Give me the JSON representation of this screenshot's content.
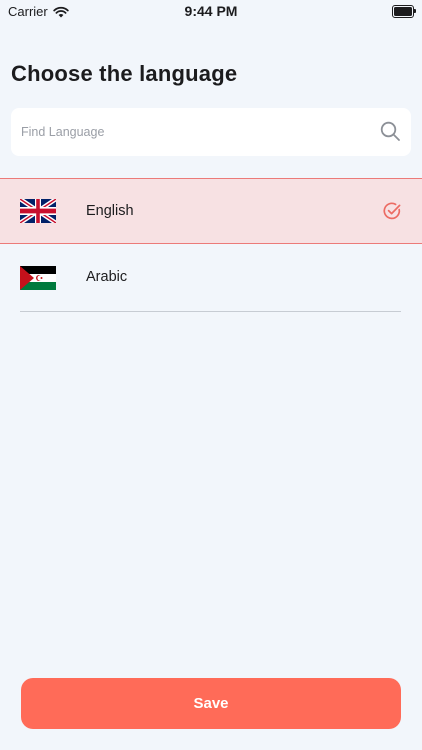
{
  "status_bar": {
    "carrier": "Carrier",
    "time": "9:44 PM",
    "icons": [
      "wifi-icon",
      "battery-icon"
    ]
  },
  "title": "Choose the language",
  "search": {
    "placeholder": "Find Language",
    "value": "",
    "icon": "search-icon"
  },
  "languages": [
    {
      "label": "English",
      "flag": "uk-flag",
      "selected": true
    },
    {
      "label": "Arabic",
      "flag": "western-sahara-flag",
      "selected": false
    }
  ],
  "selected_icon": "check-circle-icon",
  "save_label": "Save",
  "colors": {
    "background": "#f2f6fb",
    "accent": "#ff6b58",
    "selected_row_bg": "#f7e1e3",
    "selected_border": "#ec7a78",
    "check": "#ec6b63"
  }
}
